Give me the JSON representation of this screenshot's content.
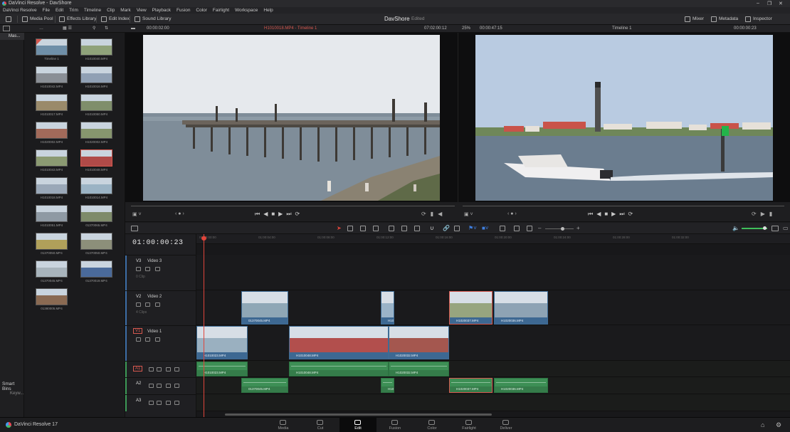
{
  "window": {
    "title": "DaVinci Resolve - DavShore"
  },
  "menu": [
    "DaVinci Resolve",
    "File",
    "Edit",
    "Trim",
    "Timeline",
    "Clip",
    "Mark",
    "View",
    "Playback",
    "Fusion",
    "Color",
    "Fairlight",
    "Workspace",
    "Help"
  ],
  "toolbar": {
    "media_pool": "Media Pool",
    "effects_library": "Effects Library",
    "edit_index": "Edit Index",
    "sound_library": "Sound Library",
    "project_name": "DavShore",
    "project_status": "Edited",
    "mixer": "Mixer",
    "metadata": "Metadata",
    "inspector": "Inspector"
  },
  "source_viewer": {
    "timecode_left": "00:00:02:00",
    "clip_title": "H1010018.MP4 - Timeline 1",
    "duration": "07:02:00:12",
    "zoom": "25%",
    "timecode": "00:00:47:15"
  },
  "timeline_viewer": {
    "title": "Timeline 1",
    "timecode": "00:00:00:23"
  },
  "left_panel": {
    "tab": "Mas...",
    "smart_bins": "Smart Bins",
    "keywords": "Keyw..."
  },
  "media_pool": {
    "clips": [
      {
        "name": "Timeline 1",
        "color": "#6f8fa8"
      },
      {
        "name": "H1010040.MP4",
        "color": "#8fa27a"
      },
      {
        "name": "H1010042.MP4",
        "color": "#8a8f96"
      },
      {
        "name": "H1010016.MP4",
        "color": "#90a0b4"
      },
      {
        "name": "H1010017.MP4",
        "color": "#9a8a6a"
      },
      {
        "name": "H1010050.MP4",
        "color": "#7f8e6b"
      },
      {
        "name": "H1020002.MP4",
        "color": "#a26a5a"
      },
      {
        "name": "H1020002.MP4",
        "color": "#87966e"
      },
      {
        "name": "H1010043.MP4",
        "color": "#8b9a72"
      },
      {
        "name": "H1010048.MP4",
        "color": "#b04a48"
      },
      {
        "name": "H1010018.MP4",
        "color": "#9aa8b8"
      },
      {
        "name": "H1010014.MP4",
        "color": "#9bb3c4"
      },
      {
        "name": "H1010051.MP4",
        "color": "#8f9aa4"
      },
      {
        "name": "01370065.MP4",
        "color": "#7e8b6a"
      },
      {
        "name": "01370050.MP4",
        "color": "#b0a05a"
      },
      {
        "name": "01370050.MP4",
        "color": "#8c8f7a"
      },
      {
        "name": "01370045.MP4",
        "color": "#a8b4bc"
      },
      {
        "name": "01370019.MP4",
        "color": "#4a6a9a"
      },
      {
        "name": "01380005.MP4",
        "color": "#8a6a52"
      }
    ]
  },
  "timeline": {
    "timecode": "01:00:00:23",
    "ruler": [
      "01:00:00:00",
      "01:00:04:00",
      "01:00:08:00",
      "01:00:12:00",
      "01:00:16:00",
      "01:00:20:00",
      "01:00:24:00",
      "01:00:28:00",
      "01:00:32:00"
    ],
    "tracks": [
      {
        "id": "V3",
        "name": "Video 3",
        "sub": "0 Clip"
      },
      {
        "id": "V2",
        "name": "Video 2",
        "sub": "4 Clips"
      },
      {
        "id": "V1",
        "name": "Video 1",
        "sub": ""
      },
      {
        "id": "A1",
        "name": "",
        "sub": ""
      },
      {
        "id": "A2",
        "name": "",
        "sub": ""
      },
      {
        "id": "A3",
        "name": "",
        "sub": ""
      }
    ],
    "v2_clips": [
      {
        "label": "01370045.MP4",
        "color": "#8fa7b6"
      },
      {
        "label": "H101...",
        "color": "#9ab3c8"
      },
      {
        "label": "H1020037.MP4",
        "color": "#97a57f"
      },
      {
        "label": "H1020036.MP4",
        "color": "#8ea3b4"
      }
    ],
    "v1_clips": [
      {
        "label": "H1010023.MP4",
        "color": "#9ab0c0"
      },
      {
        "label": "H1010048.MP4",
        "color": "#b24f4d"
      },
      {
        "label": "H1020032.MP4",
        "color": "#a4574f"
      }
    ],
    "a1_clips": [
      {
        "label": "H1010023.MP4"
      },
      {
        "label": "H1010048.MP4"
      },
      {
        "label": "H1020032.MP4"
      }
    ],
    "a2_clips": [
      {
        "label": "01370045.MP4"
      },
      {
        "label": "H101..."
      },
      {
        "label": "H1020037.MP4"
      },
      {
        "label": "H1020036.MP4"
      }
    ]
  },
  "pages": [
    "Media",
    "Cut",
    "Edit",
    "Fusion",
    "Color",
    "Fairlight",
    "Deliver"
  ],
  "active_page": "Edit",
  "brand": "DaVinci Resolve 17"
}
